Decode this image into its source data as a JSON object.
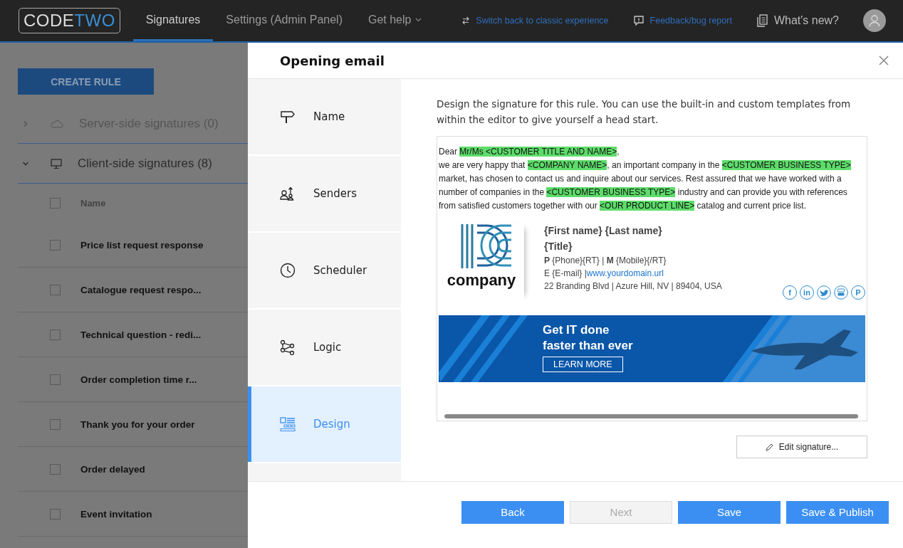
{
  "top_bar": {
    "logo": {
      "part_1": "CODE",
      "part_2": "TWO"
    },
    "nav": [
      {
        "label": "Signatures",
        "selected": true,
        "has_menu": false
      },
      {
        "label": "Settings (Admin Panel)",
        "selected": false,
        "has_menu": false
      },
      {
        "label": "Get help",
        "selected": false,
        "has_menu": true
      }
    ],
    "links": [
      {
        "kind": "switch",
        "label": "Switch back to classic experience"
      },
      {
        "kind": "feedback",
        "label": "Feedback/bug report"
      },
      {
        "kind": "news",
        "label": "What's new?"
      }
    ]
  },
  "background_page": {
    "create_button": "CREATE RULE",
    "groups": [
      {
        "kind": "cloud",
        "label": "Server-side signatures (0)",
        "expanded": false
      },
      {
        "kind": "monitor",
        "label": "Client-side signatures (8)",
        "expanded": true
      }
    ],
    "table": {
      "column": "Name",
      "header_checked": false,
      "rows": [
        {
          "name": "Price list request response",
          "checked": false
        },
        {
          "name": "Catalogue request respo...",
          "checked": false
        },
        {
          "name": "Technical question - redi...",
          "checked": false
        },
        {
          "name": "Order completion time r...",
          "checked": false
        },
        {
          "name": "Thank you for your order",
          "checked": false
        },
        {
          "name": "Order delayed",
          "checked": false
        },
        {
          "name": "Event invitation",
          "checked": false
        }
      ]
    }
  },
  "dialog": {
    "title": "Opening email",
    "steps": [
      {
        "kind": "signpost",
        "label": "Name",
        "selected": false
      },
      {
        "kind": "senders",
        "label": "Senders",
        "selected": false
      },
      {
        "kind": "clock",
        "label": "Scheduler",
        "selected": false
      },
      {
        "kind": "logic",
        "label": "Logic",
        "selected": false
      },
      {
        "kind": "design",
        "label": "Design",
        "selected": true
      }
    ],
    "intro": "Design the signature for this rule. You can use the built-in and custom templates from within the editor to give yourself a head start.",
    "preview": {
      "paragraphs": [
        [
          {
            "text": "Dear ",
            "placeholder": false
          },
          {
            "text": "Mr/Ms <CUSTOMER TITLE AND NAME>",
            "placeholder": true
          },
          {
            "text": ",",
            "placeholder": false
          }
        ],
        [
          {
            "text": "we are very happy that ",
            "placeholder": false
          },
          {
            "text": "<COMPANY NAME>",
            "placeholder": true
          },
          {
            "text": ", an important company in the ",
            "placeholder": false
          },
          {
            "text": "<CUSTOMER BUSINESS TYPE>",
            "placeholder": true
          },
          {
            "text": " market, has chosen to contact us and inquire about our services. Rest assured that we have worked with a number of companies in the ",
            "placeholder": false
          },
          {
            "text": "<CUSTOMER BUSINESS TYPE>",
            "placeholder": true
          },
          {
            "text": " industry and can provide you with references from satisfied customers together with our ",
            "placeholder": false
          },
          {
            "text": "<OUR PRODUCT LINE>",
            "placeholder": true
          },
          {
            "text": " catalog and current price list.",
            "placeholder": false
          }
        ]
      ],
      "logo_text": "company",
      "name": "{First name} {Last name}",
      "title": "{Title}",
      "phone_line": "**P** {Phone}{RT} | **M** {Mobile}{/RT}",
      "email_line": "E {E-mail} | ",
      "website": "www.yourdomain.url",
      "address": "22 Branding Blvd | Azure Hill, NV | 89404, USA",
      "social": [
        {
          "kind": "facebook",
          "glyph": "f"
        },
        {
          "kind": "linkedin",
          "glyph": "in"
        },
        {
          "kind": "twitter"
        },
        {
          "kind": "youtube"
        },
        {
          "kind": "pinterest",
          "glyph": "P"
        }
      ],
      "banner": {
        "headline": [
          "Get IT done",
          "faster than ever"
        ],
        "button": "LEARN MORE"
      }
    },
    "edit_button": "Edit signature...",
    "buttons": [
      {
        "label": "Back",
        "disabled": false
      },
      {
        "label": "Next",
        "disabled": true
      },
      {
        "label": "Save",
        "disabled": false
      },
      {
        "label": "Save & Publish",
        "disabled": false
      }
    ]
  }
}
